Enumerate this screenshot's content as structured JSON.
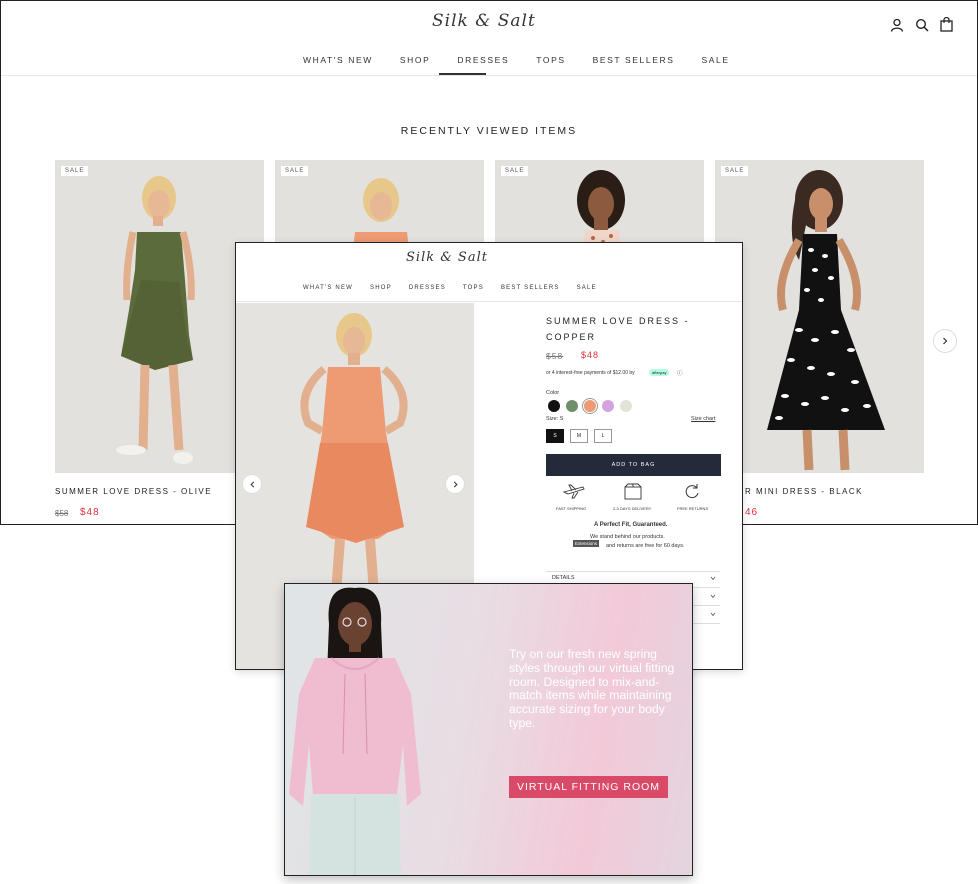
{
  "brand": {
    "logo": "Silk & Salt"
  },
  "nav": [
    "WHAT'S NEW",
    "SHOP",
    "DRESSES",
    "TOPS",
    "BEST SELLERS",
    "SALE"
  ],
  "nav_active": "DRESSES",
  "recently_viewed": {
    "title": "RECENTLY VIEWED ITEMS",
    "items": [
      {
        "badge": "SALE",
        "name": "SUMMER LOVE DRESS - OLIVE",
        "old_price": "$58",
        "price": "$48"
      },
      {
        "badge": "SALE"
      },
      {
        "badge": "SALE"
      },
      {
        "badge": "SALE",
        "name": "R MINI DRESS - BLACK",
        "price": "46"
      }
    ]
  },
  "product": {
    "title_line1": "SUMMER LOVE DRESS -",
    "title_line2": "COPPER",
    "old_price": "$58",
    "price": "$48",
    "afterpay": "or 4 interest-free payments of $12.00 by",
    "afterpay_badge": "afterpay",
    "afterpay_info": "ⓘ",
    "color_label": "Color",
    "colors": [
      "#111111",
      "#6e8f6a",
      "#ee9a72",
      "#d3a3e0",
      "#e3e3da"
    ],
    "size_label": "Size: S",
    "size_chart": "Size chart",
    "sizes": [
      "S",
      "M",
      "L"
    ],
    "add_to_bag": "ADD TO BAG",
    "features": [
      "FAST SHIPPING",
      "2-3 DAYS DELIVERY",
      "FREE RETURNS"
    ],
    "guarantee_title": "A Perfect Fit, Guaranteed.",
    "guarantee_line1": "We stand behind our products.",
    "guarantee_line2": "and returns are free for 60 days.",
    "tooltip": "Extensions",
    "details": "DETAILS"
  },
  "promo": {
    "text": "Try on our fresh new spring styles through our virtual fitting room. Designed to mix-and-match items while maintaining accurate sizing for your body type.",
    "button": "VIRTUAL FITTING ROOM"
  },
  "colors": {
    "sale_red": "#e0303a",
    "button_navy": "#232a3a",
    "promo_pink": "#d94a68"
  }
}
